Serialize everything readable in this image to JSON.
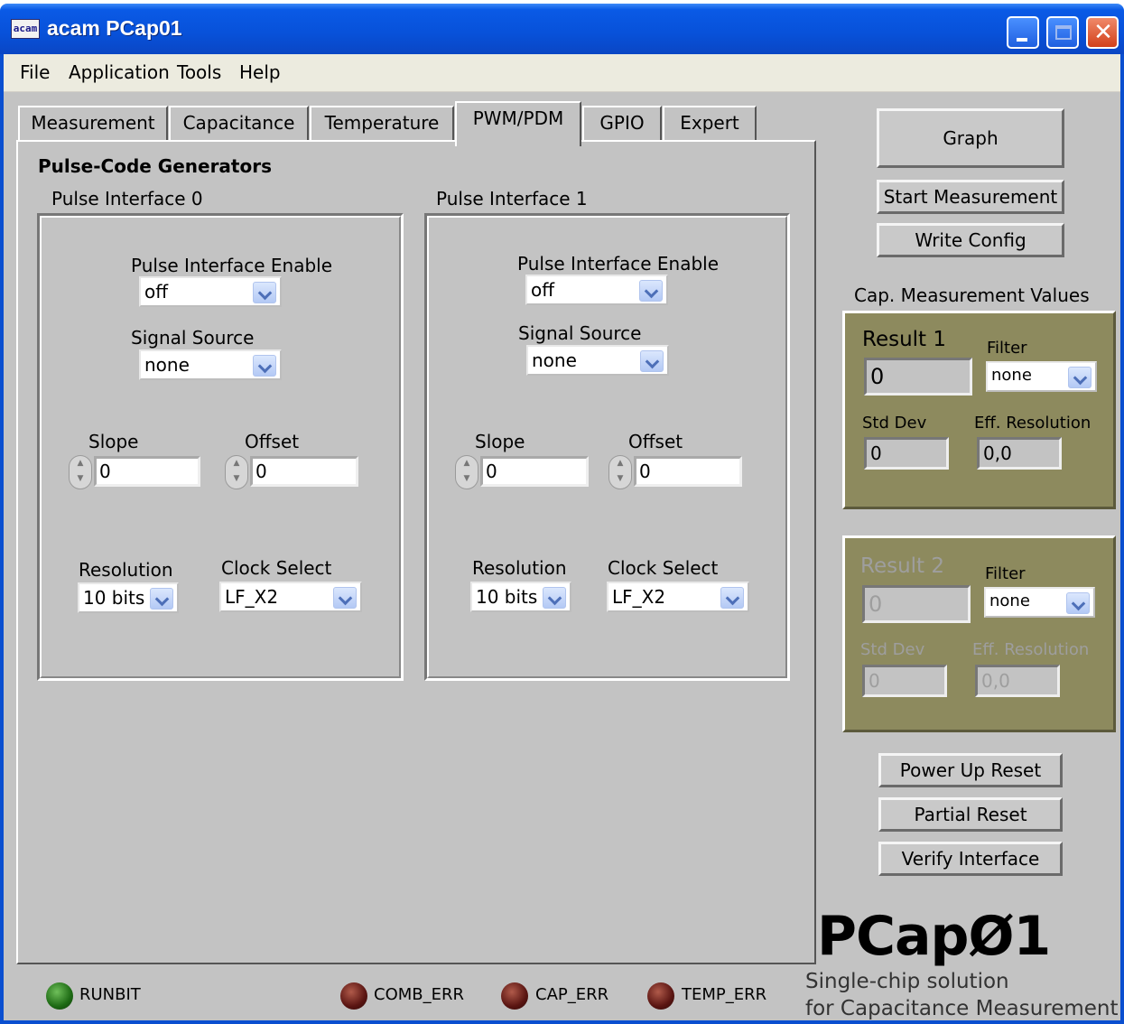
{
  "window": {
    "title": "acam PCap01",
    "icon_text": "acam"
  },
  "menu": [
    "File",
    "Application",
    "Tools",
    "Help"
  ],
  "tabs": [
    "Measurement",
    "Capacitance",
    "Temperature",
    "PWM/PDM",
    "GPIO",
    "Expert"
  ],
  "active_tab": "PWM/PDM",
  "section_title": "Pulse-Code Generators",
  "pulse_interfaces": [
    {
      "title": "Pulse Interface 0",
      "enable_label": "Pulse Interface Enable",
      "enable_value": "off",
      "source_label": "Signal Source",
      "source_value": "none",
      "slope_label": "Slope",
      "slope_value": "0",
      "offset_label": "Offset",
      "offset_value": "0",
      "resolution_label": "Resolution",
      "resolution_value": "10 bits",
      "clock_label": "Clock Select",
      "clock_value": "LF_X2"
    },
    {
      "title": "Pulse Interface 1",
      "enable_label": "Pulse Interface Enable",
      "enable_value": "off",
      "source_label": "Signal Source",
      "source_value": "none",
      "slope_label": "Slope",
      "slope_value": "0",
      "offset_label": "Offset",
      "offset_value": "0",
      "resolution_label": "Resolution",
      "resolution_value": "10 bits",
      "clock_label": "Clock Select",
      "clock_value": "LF_X2"
    }
  ],
  "buttons": {
    "graph": "Graph",
    "start": "Start Measurement",
    "write": "Write Config",
    "power_reset": "Power Up Reset",
    "partial_reset": "Partial Reset",
    "verify": "Verify Interface"
  },
  "cap_values_title": "Cap. Measurement Values",
  "results": [
    {
      "label": "Result 1",
      "value": "0",
      "filter_label": "Filter",
      "filter_value": "none",
      "std_label": "Std Dev",
      "std_value": "0",
      "eff_label": "Eff. Resolution",
      "eff_value": "0,0",
      "enabled": true
    },
    {
      "label": "Result 2",
      "value": "0",
      "filter_label": "Filter",
      "filter_value": "none",
      "std_label": "Std Dev",
      "std_value": "0",
      "eff_label": "Eff. Resolution",
      "eff_value": "0,0",
      "enabled": false
    }
  ],
  "indicators": [
    {
      "label": "RUNBIT",
      "color": "#2e7d1e"
    },
    {
      "label": "COMB_ERR",
      "color": "#5a1512"
    },
    {
      "label": "CAP_ERR",
      "color": "#5a1512"
    },
    {
      "label": "TEMP_ERR",
      "color": "#5a1512"
    }
  ],
  "branding": {
    "product": "PCapØ1",
    "tagline_1": "Single-chip solution",
    "tagline_2": "for Capacitance Measurement"
  }
}
